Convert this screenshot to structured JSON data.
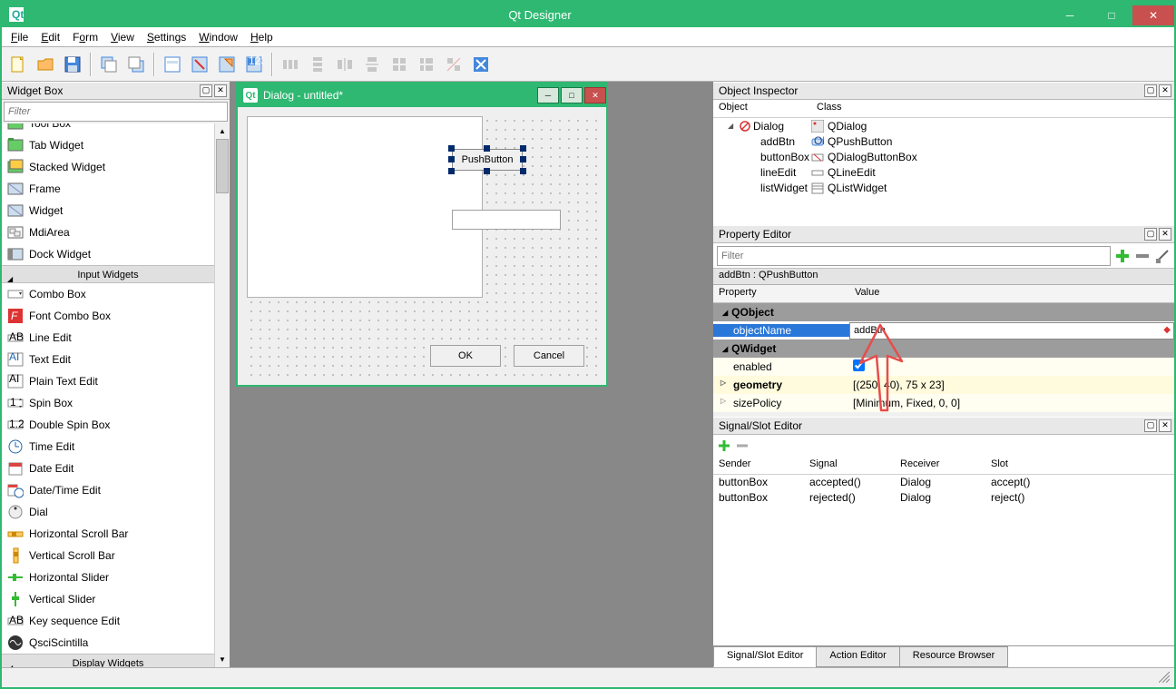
{
  "app": {
    "title": "Qt Designer"
  },
  "menu": {
    "file": "File",
    "edit": "Edit",
    "form": "Form",
    "view": "View",
    "settings": "Settings",
    "window": "Window",
    "help": "Help"
  },
  "widget_box": {
    "title": "Widget Box",
    "filter_placeholder": "Filter",
    "truncated_top": "Tool Box",
    "items_containers": [
      "Tab Widget",
      "Stacked Widget",
      "Frame",
      "Widget",
      "MdiArea",
      "Dock Widget"
    ],
    "cat_input": "Input Widgets",
    "items_input": [
      "Combo Box",
      "Font Combo Box",
      "Line Edit",
      "Text Edit",
      "Plain Text Edit",
      "Spin Box",
      "Double Spin Box",
      "Time Edit",
      "Date Edit",
      "Date/Time Edit",
      "Dial",
      "Horizontal Scroll Bar",
      "Vertical Scroll Bar",
      "Horizontal Slider",
      "Vertical Slider",
      "Key sequence Edit",
      "QsciScintilla"
    ],
    "cat_display": "Display Widgets"
  },
  "designer": {
    "subtitle": "Dialog - untitled*",
    "pushbtn": "PushButton",
    "ok": "OK",
    "cancel": "Cancel"
  },
  "object_inspector": {
    "title": "Object Inspector",
    "h1": "Object",
    "h2": "Class",
    "rows": [
      {
        "obj": "Dialog",
        "cls": "QDialog"
      },
      {
        "obj": "addBtn",
        "cls": "QPushButton"
      },
      {
        "obj": "buttonBox",
        "cls": "QDialogButtonBox"
      },
      {
        "obj": "lineEdit",
        "cls": "QLineEdit"
      },
      {
        "obj": "listWidget",
        "cls": "QListWidget"
      }
    ]
  },
  "property_editor": {
    "title": "Property Editor",
    "filter_placeholder": "Filter",
    "obj_label": "addBtn : QPushButton",
    "h1": "Property",
    "h2": "Value",
    "grp1": "QObject",
    "objectName_label": "objectName",
    "objectName_val": "addBtn",
    "grp2": "QWidget",
    "enabled_label": "enabled",
    "geometry_label": "geometry",
    "geometry_val": "[(250, 40), 75 x 23]",
    "sizePolicy_label": "sizePolicy",
    "sizePolicy_val": "[Minimum, Fixed, 0, 0]"
  },
  "signal_slot": {
    "title": "Signal/Slot Editor",
    "h1": "Sender",
    "h2": "Signal",
    "h3": "Receiver",
    "h4": "Slot",
    "rows": [
      {
        "s": "buttonBox",
        "sg": "accepted()",
        "r": "Dialog",
        "sl": "accept()"
      },
      {
        "s": "buttonBox",
        "sg": "rejected()",
        "r": "Dialog",
        "sl": "reject()"
      }
    ],
    "tab1": "Signal/Slot Editor",
    "tab2": "Action Editor",
    "tab3": "Resource Browser"
  }
}
